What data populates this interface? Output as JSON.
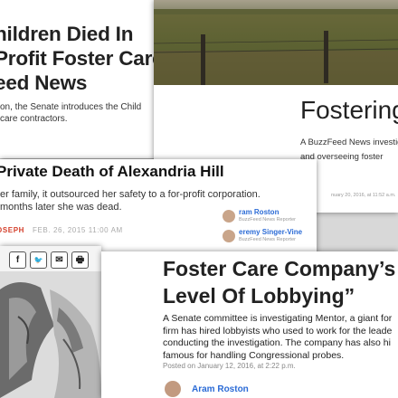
{
  "card1": {
    "headline_line1": "hildren Died In",
    "headline_line2": "Profit Foster Care",
    "headline_line3": "eed News",
    "summary_line1": "on, the Senate introduces the Child",
    "summary_line2": "care contractors."
  },
  "card2": {
    "title": "Fostering",
    "intro_line1": "A BuzzFeed News investigat",
    "intro_line2": "and overseeing foster",
    "date": "nuary 20, 2016, at 11:52 a.m."
  },
  "card3": {
    "headline": "Private Death of Alexandria Hill",
    "dek_line1": "er family, it outsourced her safety to a for-profit corporation.",
    "dek_line2": "months later she was dead.",
    "byline": "OSEPH",
    "date": "FEB. 26, 2015 11:00 AM",
    "authors": [
      {
        "name": "ram Roston",
        "role": "BuzzFeed News Reporter"
      },
      {
        "name": "eremy Singer-Vine",
        "role": "BuzzFeed News Reporter"
      }
    ]
  },
  "card4": {
    "share_buttons": [
      {
        "icon": "facebook-icon",
        "glyph": "f"
      },
      {
        "icon": "twitter-icon",
        "glyph": "🐦"
      },
      {
        "icon": "email-icon",
        "glyph": "✉"
      },
      {
        "icon": "print-icon",
        "glyph": "🖶"
      }
    ]
  },
  "card5": {
    "headline_line1": "Foster Care Company’s",
    "headline_line2": "Level Of Lobbying”",
    "summary_line1": "A Senate committee is investigating Mentor, a giant for",
    "summary_line2": "firm has hired lobbyists who used to work for the leade",
    "summary_line3": "conducting the investigation. The company has also hi",
    "summary_line4": "famous for handling Congressional probes.",
    "posted": "Posted on January 12, 2016, at 2:22 p.m.",
    "author": "Aram Roston"
  },
  "colors": {
    "link": "#2b6bd6",
    "byline_red": "#d4402c"
  }
}
